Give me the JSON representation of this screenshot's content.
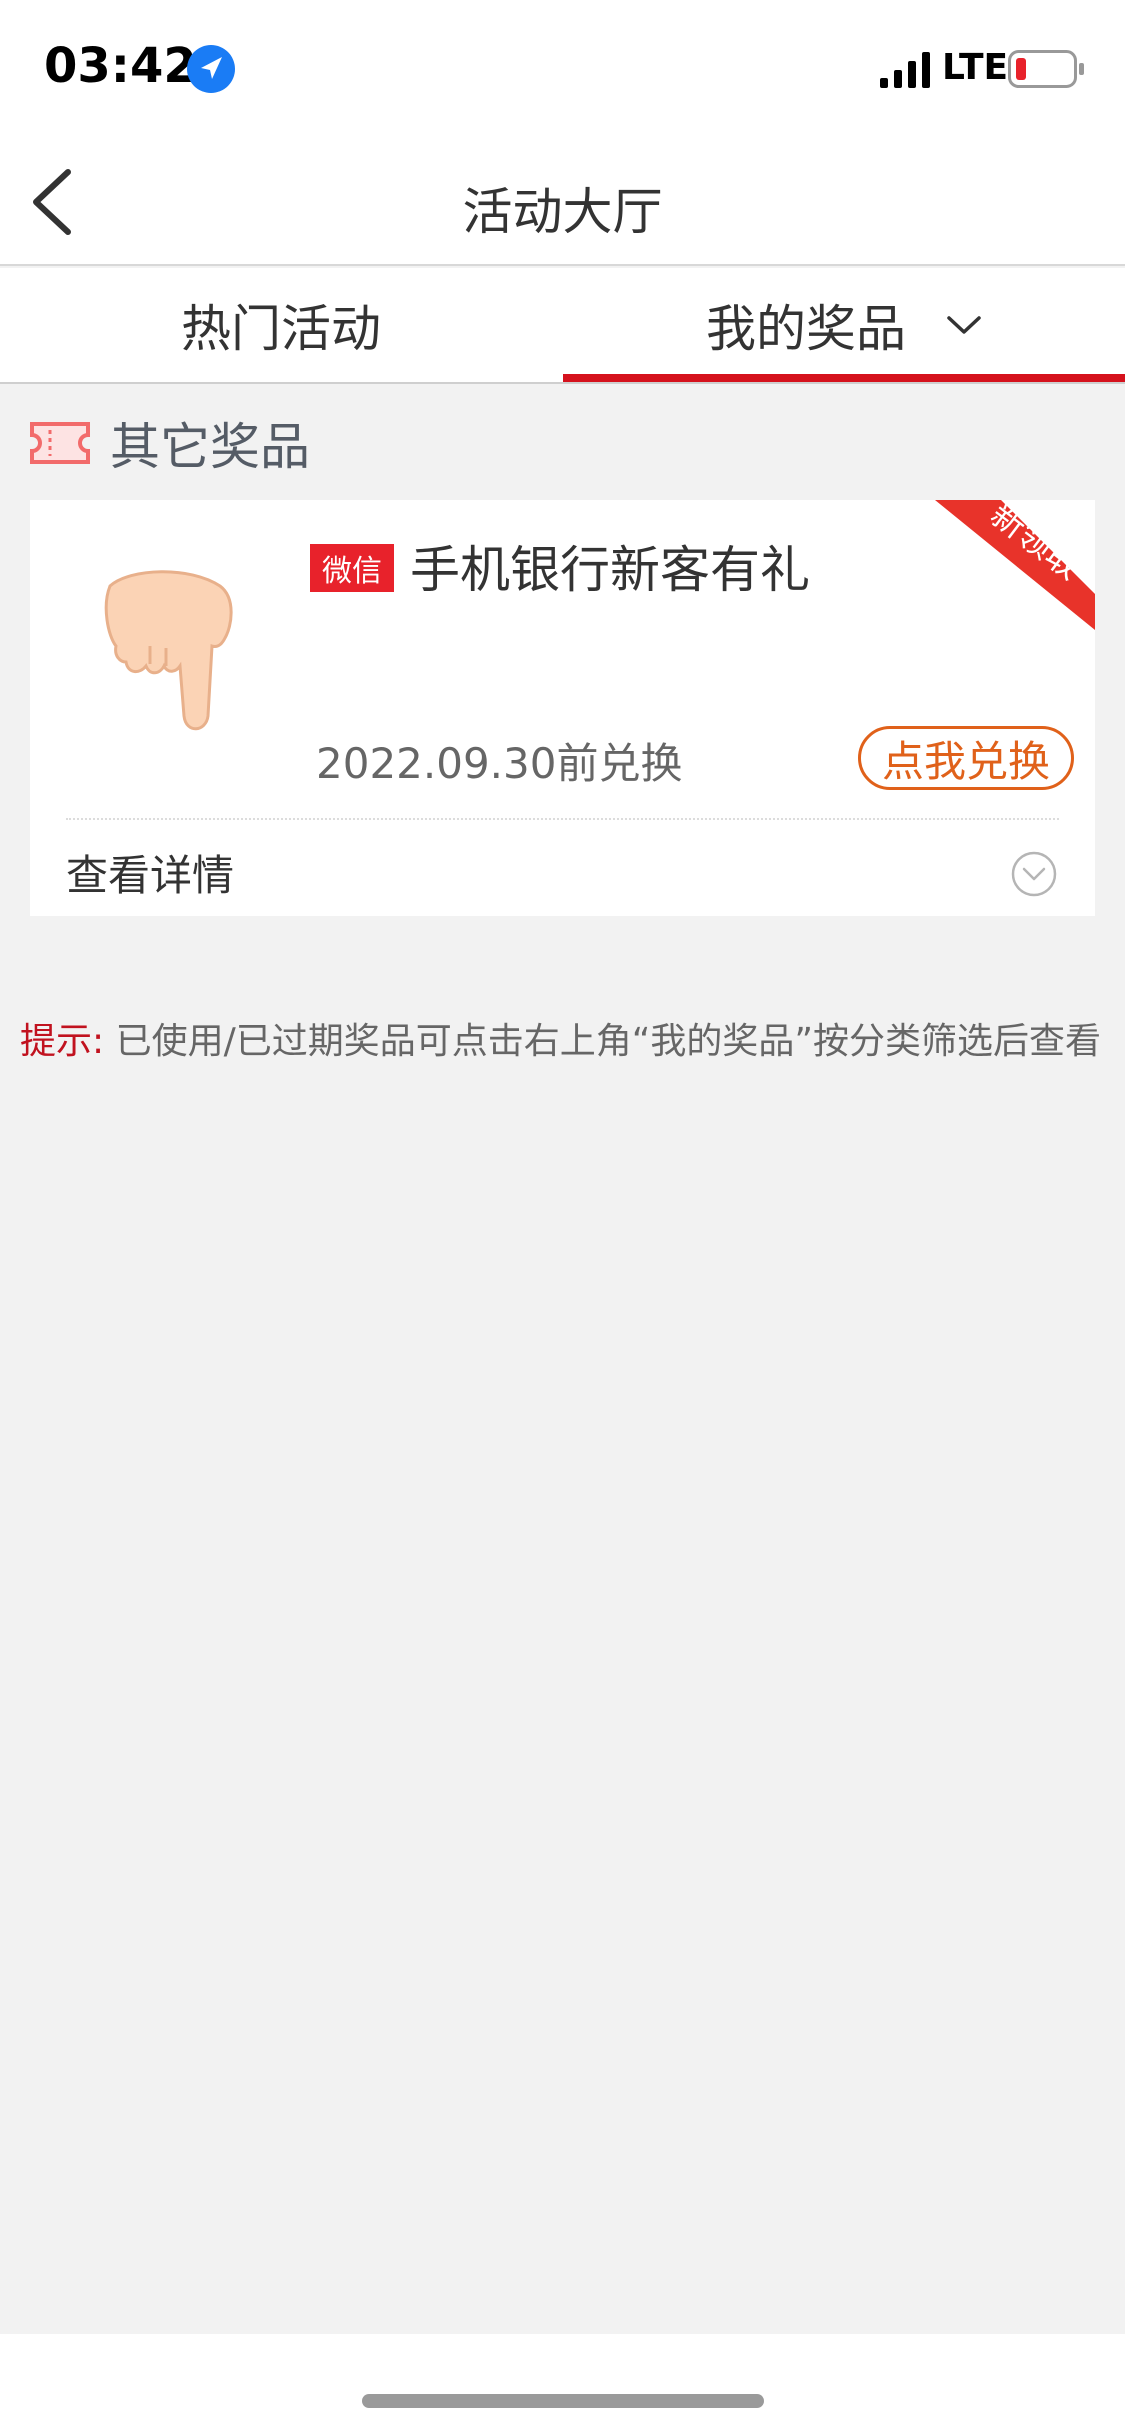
{
  "status_bar": {
    "time": "03:42",
    "network": "LTE",
    "icons": [
      "location-arrow-icon",
      "signal-icon",
      "battery-low-icon"
    ],
    "battery_color": "#e8222b"
  },
  "nav": {
    "title": "活动大厅",
    "back_icon": "chevron-left-icon"
  },
  "tabs": [
    {
      "label": "热门活动",
      "active": false
    },
    {
      "label": "我的奖品",
      "active": true,
      "dropdown_icon": "chevron-down-icon"
    }
  ],
  "section": {
    "title": "其它奖品",
    "icon": "ticket-icon"
  },
  "prize": {
    "channel": "微信",
    "name": "手机银行新客有礼",
    "deadline": "2022.09.30前兑换",
    "redeem_label": "点我兑换",
    "ribbon": "新领取",
    "details_label": "查看详情",
    "thumbnail_icon": "pointing-hand-icon",
    "expand_icon": "circle-chevron-down-icon"
  },
  "tip": {
    "label": "提示:",
    "text": "已使用/已过期奖品可点击右上角“我的奖品”按分类筛选后查看"
  },
  "colors": {
    "accent_red": "#d5121d",
    "redeem_orange": "#e0611a",
    "badge_red": "#e8222b",
    "background": "#f2f2f2"
  }
}
